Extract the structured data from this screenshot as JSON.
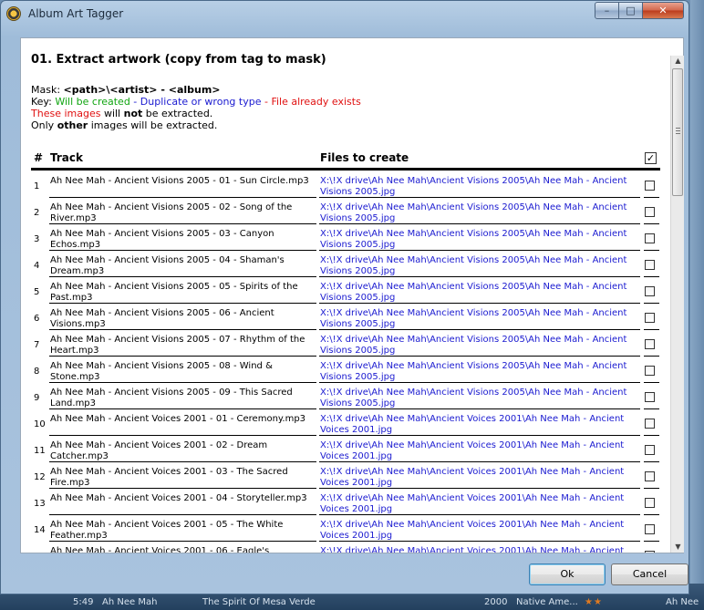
{
  "window": {
    "title": "Album Art Tagger"
  },
  "caption_buttons": {
    "minimize": "–",
    "maximize": "□",
    "close": "✕"
  },
  "heading": "01. Extract artwork (copy from tag to mask)",
  "mask": {
    "label": "Mask: ",
    "value": "<path>\\<artist> - <album>"
  },
  "key": {
    "label": "Key: ",
    "will_be_created": "Will be created",
    "sep1": " - ",
    "duplicate": "Duplicate or wrong type",
    "sep2": " - ",
    "exists": "File already exists"
  },
  "note1": {
    "red_part": "These images",
    "mid": " will ",
    "bold": "not",
    "end": " be extracted."
  },
  "note2": {
    "start": "Only ",
    "bold": "other",
    "end": " images will be extracted."
  },
  "table": {
    "columns": {
      "num": "#",
      "track": "Track",
      "files": "Files to create"
    },
    "header_checked": true,
    "rows": [
      {
        "num": "1",
        "track": "Ah Nee Mah - Ancient Visions 2005 - 01 - Sun Circle.mp3",
        "file": "X:\\!X drive\\Ah Nee Mah\\Ancient Visions 2005\\Ah Nee Mah - Ancient Visions 2005.jpg"
      },
      {
        "num": "2",
        "track": "Ah Nee Mah - Ancient Visions 2005 - 02 - Song of the River.mp3",
        "file": "X:\\!X drive\\Ah Nee Mah\\Ancient Visions 2005\\Ah Nee Mah - Ancient Visions 2005.jpg"
      },
      {
        "num": "3",
        "track": "Ah Nee Mah - Ancient Visions 2005 - 03 - Canyon Echos.mp3",
        "file": "X:\\!X drive\\Ah Nee Mah\\Ancient Visions 2005\\Ah Nee Mah - Ancient Visions 2005.jpg"
      },
      {
        "num": "4",
        "track": "Ah Nee Mah - Ancient Visions 2005 - 04 - Shaman's Dream.mp3",
        "file": "X:\\!X drive\\Ah Nee Mah\\Ancient Visions 2005\\Ah Nee Mah - Ancient Visions 2005.jpg"
      },
      {
        "num": "5",
        "track": "Ah Nee Mah - Ancient Visions 2005 - 05 - Spirits of the Past.mp3",
        "file": "X:\\!X drive\\Ah Nee Mah\\Ancient Visions 2005\\Ah Nee Mah - Ancient Visions 2005.jpg"
      },
      {
        "num": "6",
        "track": "Ah Nee Mah - Ancient Visions 2005 - 06 - Ancient Visions.mp3",
        "file": "X:\\!X drive\\Ah Nee Mah\\Ancient Visions 2005\\Ah Nee Mah - Ancient Visions 2005.jpg"
      },
      {
        "num": "7",
        "track": "Ah Nee Mah - Ancient Visions 2005 - 07 - Rhythm of the Heart.mp3",
        "file": "X:\\!X drive\\Ah Nee Mah\\Ancient Visions 2005\\Ah Nee Mah - Ancient Visions 2005.jpg"
      },
      {
        "num": "8",
        "track": "Ah Nee Mah - Ancient Visions 2005 - 08 - Wind & Stone.mp3",
        "file": "X:\\!X drive\\Ah Nee Mah\\Ancient Visions 2005\\Ah Nee Mah - Ancient Visions 2005.jpg"
      },
      {
        "num": "9",
        "track": "Ah Nee Mah - Ancient Visions 2005 - 09 - This Sacred Land.mp3",
        "file": "X:\\!X drive\\Ah Nee Mah\\Ancient Visions 2005\\Ah Nee Mah - Ancient Visions 2005.jpg"
      },
      {
        "num": "10",
        "track": "Ah Nee Mah - Ancient Voices 2001 - 01 - Ceremony.mp3",
        "file": "X:\\!X drive\\Ah Nee Mah\\Ancient Voices 2001\\Ah Nee Mah - Ancient Voices 2001.jpg"
      },
      {
        "num": "11",
        "track": "Ah Nee Mah - Ancient Voices 2001 - 02 - Dream Catcher.mp3",
        "file": "X:\\!X drive\\Ah Nee Mah\\Ancient Voices 2001\\Ah Nee Mah - Ancient Voices 2001.jpg"
      },
      {
        "num": "12",
        "track": "Ah Nee Mah - Ancient Voices 2001 - 03 - The Sacred Fire.mp3",
        "file": "X:\\!X drive\\Ah Nee Mah\\Ancient Voices 2001\\Ah Nee Mah - Ancient Voices 2001.jpg"
      },
      {
        "num": "13",
        "track": "Ah Nee Mah - Ancient Voices 2001 - 04 - Storyteller.mp3",
        "file": "X:\\!X drive\\Ah Nee Mah\\Ancient Voices 2001\\Ah Nee Mah - Ancient Voices 2001.jpg"
      },
      {
        "num": "14",
        "track": "Ah Nee Mah - Ancient Voices 2001 - 05 - The White Feather.mp3",
        "file": "X:\\!X drive\\Ah Nee Mah\\Ancient Voices 2001\\Ah Nee Mah - Ancient Voices 2001.jpg"
      },
      {
        "num": "15",
        "track": "Ah Nee Mah - Ancient Voices 2001 - 06 - Eagle's",
        "file": "X:\\!X drive\\Ah Nee Mah\\Ancient Voices 2001\\Ah Nee Mah - Ancient"
      }
    ]
  },
  "buttons": {
    "ok": "Ok",
    "cancel": "Cancel"
  },
  "background_row": {
    "time": "5:49",
    "artist": "Ah Nee Mah",
    "title": "The Spirit Of Mesa Verde",
    "year": "2000",
    "genre": "Native Ame...",
    "stars": "★★",
    "artist2": "Ah Nee"
  },
  "colors": {
    "will_be_created": "#11a511",
    "duplicate": "#1a1ad0",
    "exists": "#e01010"
  }
}
